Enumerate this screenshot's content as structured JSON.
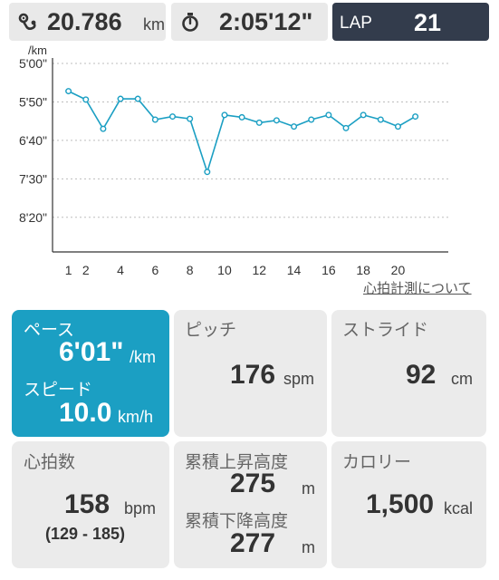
{
  "topbar": {
    "distance": {
      "icon": "route-icon",
      "value": "20.786",
      "unit": "km"
    },
    "time": {
      "icon": "stopwatch-icon",
      "value": "2:05'12\""
    },
    "lap": {
      "label": "LAP",
      "value": "21"
    }
  },
  "chart_data": {
    "type": "line",
    "y_unit_label": "/km",
    "y_ticks": [
      "5'00\"",
      "5'50\"",
      "6'40\"",
      "7'30\"",
      "8'20\""
    ],
    "y_tick_seconds": [
      300,
      350,
      400,
      450,
      500
    ],
    "ylim": [
      300,
      545
    ],
    "x_ticks": [
      "1",
      "2",
      "4",
      "6",
      "8",
      "10",
      "12",
      "14",
      "16",
      "18",
      "20"
    ],
    "x": [
      1,
      2,
      3,
      4,
      5,
      6,
      7,
      8,
      9,
      10,
      11,
      12,
      13,
      14,
      15,
      16,
      17,
      18,
      19,
      20,
      21
    ],
    "pace_seconds": [
      336,
      347,
      385,
      346,
      346,
      373,
      369,
      372,
      441,
      367,
      370,
      377,
      374,
      382,
      373,
      367,
      384,
      367,
      373,
      382,
      369
    ],
    "line_color": "#1b9fc3",
    "grid": true
  },
  "heart_rate_link": "心拍計測について",
  "cards": {
    "pace": {
      "label": "ペース",
      "value": "6'01\"",
      "unit": "/km"
    },
    "speed": {
      "label": "スピード",
      "value": "10.0",
      "unit": "km/h"
    },
    "pitch": {
      "label": "ピッチ",
      "value": "176",
      "unit": "spm"
    },
    "stride": {
      "label": "ストライド",
      "value": "92",
      "unit": "cm"
    },
    "heart_rate": {
      "label": "心拍数",
      "value": "158",
      "unit": "bpm",
      "range": "(129 - 185)"
    },
    "elevation_up": {
      "label": "累積上昇高度",
      "value": "275",
      "unit": "m"
    },
    "elevation_down": {
      "label": "累積下降高度",
      "value": "277",
      "unit": "m"
    },
    "calories": {
      "label": "カロリー",
      "value": "1,500",
      "unit": "kcal"
    }
  },
  "colors": {
    "accent": "#1b9fc3",
    "lap_bg": "#333c4c",
    "card_bg": "#ebebeb"
  }
}
